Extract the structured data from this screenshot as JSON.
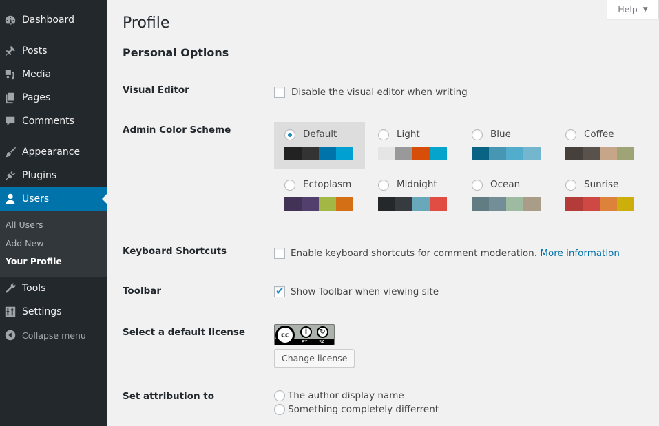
{
  "sidebar": {
    "items": [
      {
        "label": "Dashboard",
        "icon": "dashboard-icon"
      },
      {
        "label": "Posts",
        "icon": "pin-icon"
      },
      {
        "label": "Media",
        "icon": "media-icon"
      },
      {
        "label": "Pages",
        "icon": "pages-icon"
      },
      {
        "label": "Comments",
        "icon": "comment-icon"
      },
      {
        "label": "Appearance",
        "icon": "paintbrush-icon"
      },
      {
        "label": "Plugins",
        "icon": "plugin-icon"
      },
      {
        "label": "Users",
        "icon": "user-icon",
        "active": true
      },
      {
        "label": "Tools",
        "icon": "wrench-icon"
      },
      {
        "label": "Settings",
        "icon": "settings-icon"
      }
    ],
    "submenu": [
      "All Users",
      "Add New",
      "Your Profile"
    ],
    "collapse_label": "Collapse menu"
  },
  "help": {
    "label": "Help",
    "arrow": "▼"
  },
  "page": {
    "title": "Profile",
    "section": "Personal Options",
    "visual_editor": {
      "label": "Visual Editor",
      "option": "Disable the visual editor when writing",
      "checked": false
    },
    "color_scheme": {
      "label": "Admin Color Scheme",
      "selected": "Default",
      "schemes": [
        {
          "name": "Default",
          "colors": [
            "#222222",
            "#333333",
            "#0073aa",
            "#00a0d2"
          ]
        },
        {
          "name": "Light",
          "colors": [
            "#e5e5e5",
            "#999999",
            "#d64e07",
            "#04a4cc"
          ]
        },
        {
          "name": "Blue",
          "colors": [
            "#096484",
            "#4796b3",
            "#52accc",
            "#74b6ce"
          ]
        },
        {
          "name": "Coffee",
          "colors": [
            "#46403c",
            "#59524c",
            "#c7a589",
            "#9ea476"
          ]
        },
        {
          "name": "Ectoplasm",
          "colors": [
            "#413256",
            "#523f6d",
            "#a3b745",
            "#d46f15"
          ]
        },
        {
          "name": "Midnight",
          "colors": [
            "#25282b",
            "#363b3f",
            "#69a8bb",
            "#e14d43"
          ]
        },
        {
          "name": "Ocean",
          "colors": [
            "#627c83",
            "#738e96",
            "#9ebaa0",
            "#aa9d88"
          ]
        },
        {
          "name": "Sunrise",
          "colors": [
            "#b43c38",
            "#cf4944",
            "#dd823b",
            "#ccaf0b"
          ]
        }
      ]
    },
    "keyboard_shortcuts": {
      "label": "Keyboard Shortcuts",
      "option": "Enable keyboard shortcuts for comment moderation.",
      "link": "More information",
      "checked": false
    },
    "toolbar": {
      "label": "Toolbar",
      "option": "Show Toolbar when viewing site",
      "checked": true,
      "check_glyph": "✔"
    },
    "license": {
      "label": "Select a default license",
      "badge_cc": "cc",
      "badge_by": "BY",
      "badge_sa": "SA",
      "button": "Change license"
    },
    "attribution": {
      "label": "Set attribution to",
      "options": [
        "The author display name",
        "Something completely differrent"
      ]
    }
  }
}
